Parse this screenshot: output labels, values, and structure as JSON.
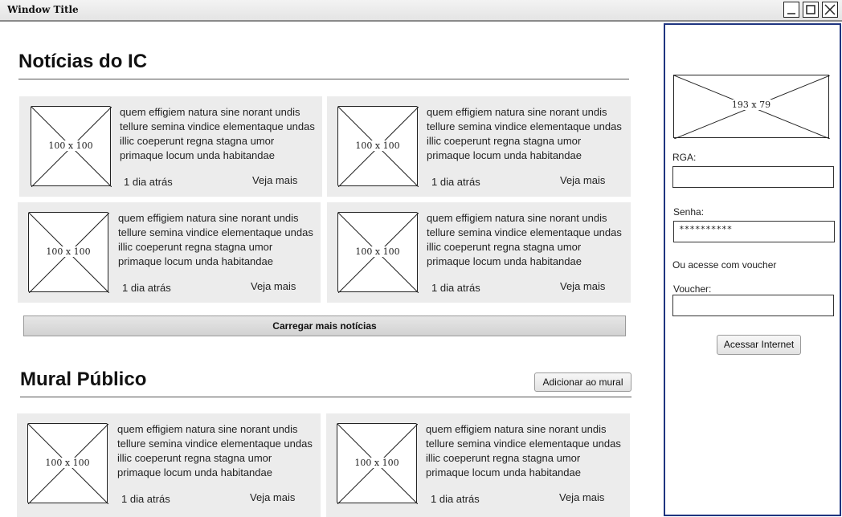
{
  "window": {
    "title": "Window Title"
  },
  "noticias": {
    "title": "Notícias do IC",
    "cards": [
      {
        "img": "100 x 100",
        "text": "quem effigiem natura sine norant undis tellure semina vindice elementaque undas illic coeperunt regna stagna umor primaque locum unda habitandae",
        "time": "1 dia atrás",
        "more": "Veja mais"
      },
      {
        "img": "100 x 100",
        "text": "quem effigiem natura sine norant undis tellure semina vindice elementaque undas illic coeperunt regna stagna umor primaque locum unda habitandae",
        "time": "1 dia atrás",
        "more": "Veja mais"
      },
      {
        "img": "100 x 100",
        "text": "quem effigiem natura sine norant undis tellure semina vindice elementaque undas illic coeperunt regna stagna umor primaque locum unda habitandae",
        "time": "1 dia atrás",
        "more": "Veja mais"
      },
      {
        "img": "100 x 100",
        "text": "quem effigiem natura sine norant undis tellure semina vindice elementaque undas illic coeperunt regna stagna umor primaque locum unda habitandae",
        "time": "1 dia atrás",
        "more": "Veja mais"
      }
    ],
    "load_more": "Carregar mais notícias"
  },
  "mural": {
    "title": "Mural Público",
    "add_button": "Adicionar ao mural",
    "cards": [
      {
        "img": "100 x 100",
        "text": "quem effigiem natura sine norant undis tellure semina vindice elementaque undas illic coeperunt regna stagna umor primaque locum unda habitandae",
        "time": "1 dia atrás",
        "more": "Veja mais"
      },
      {
        "img": "100 x 100",
        "text": "quem effigiem natura sine norant undis tellure semina vindice elementaque undas illic coeperunt regna stagna umor primaque locum unda habitandae",
        "time": "1 dia atrás",
        "more": "Veja mais"
      }
    ]
  },
  "sidebar": {
    "logo": "193 x 79",
    "rga_label": "RGA:",
    "rga_value": "",
    "senha_label": "Senha:",
    "senha_value": "**********",
    "or_voucher": "Ou acesse com voucher",
    "voucher_label": "Voucher:",
    "voucher_value": "",
    "submit": "Acessar Internet"
  }
}
